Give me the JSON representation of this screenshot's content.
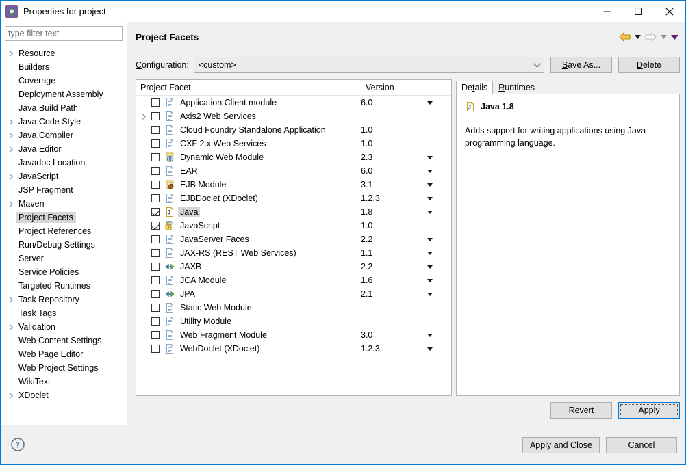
{
  "window": {
    "title": "Properties for project",
    "icon": "project-properties-icon",
    "minimize_label": "minimize-icon",
    "maximize_label": "maximize-icon",
    "close_label": "close-icon"
  },
  "sidebar": {
    "filter_placeholder": "type filter text",
    "filter_value": "",
    "items": [
      {
        "label": "Resource",
        "expandable": true,
        "selected": false
      },
      {
        "label": "Builders",
        "expandable": false,
        "selected": false
      },
      {
        "label": "Coverage",
        "expandable": false,
        "selected": false
      },
      {
        "label": "Deployment Assembly",
        "expandable": false,
        "selected": false
      },
      {
        "label": "Java Build Path",
        "expandable": false,
        "selected": false
      },
      {
        "label": "Java Code Style",
        "expandable": true,
        "selected": false
      },
      {
        "label": "Java Compiler",
        "expandable": true,
        "selected": false
      },
      {
        "label": "Java Editor",
        "expandable": true,
        "selected": false
      },
      {
        "label": "Javadoc Location",
        "expandable": false,
        "selected": false
      },
      {
        "label": "JavaScript",
        "expandable": true,
        "selected": false
      },
      {
        "label": "JSP Fragment",
        "expandable": false,
        "selected": false
      },
      {
        "label": "Maven",
        "expandable": true,
        "selected": false
      },
      {
        "label": "Project Facets",
        "expandable": false,
        "selected": true
      },
      {
        "label": "Project References",
        "expandable": false,
        "selected": false
      },
      {
        "label": "Run/Debug Settings",
        "expandable": false,
        "selected": false
      },
      {
        "label": "Server",
        "expandable": false,
        "selected": false
      },
      {
        "label": "Service Policies",
        "expandable": false,
        "selected": false
      },
      {
        "label": "Targeted Runtimes",
        "expandable": false,
        "selected": false
      },
      {
        "label": "Task Repository",
        "expandable": true,
        "selected": false
      },
      {
        "label": "Task Tags",
        "expandable": false,
        "selected": false
      },
      {
        "label": "Validation",
        "expandable": true,
        "selected": false
      },
      {
        "label": "Web Content Settings",
        "expandable": false,
        "selected": false
      },
      {
        "label": "Web Page Editor",
        "expandable": false,
        "selected": false
      },
      {
        "label": "Web Project Settings",
        "expandable": false,
        "selected": false
      },
      {
        "label": "WikiText",
        "expandable": false,
        "selected": false
      },
      {
        "label": "XDoclet",
        "expandable": true,
        "selected": false
      }
    ]
  },
  "page": {
    "title": "Project Facets",
    "nav": {
      "back_icon": "back-arrow-icon",
      "back_menu_icon": "chevron-down-icon",
      "forward_icon": "forward-arrow-icon",
      "forward_menu_icon": "chevron-down-icon",
      "view_menu_icon": "chevron-down-icon"
    }
  },
  "configuration": {
    "label": "Configuration:",
    "label_mnemonic": "C",
    "selected": "<custom>",
    "dropdown_icon": "chevron-down-icon",
    "save_as_label": "Save As...",
    "save_as_mnemonic": "S",
    "delete_label": "Delete",
    "delete_mnemonic": "D"
  },
  "facet_table": {
    "columns": [
      "Project Facet",
      "Version",
      ""
    ],
    "rows": [
      {
        "name": "Application Client module",
        "version": "6.0",
        "checked": false,
        "icon": "document-icon",
        "expandable": false,
        "has_version_menu": true
      },
      {
        "name": "Axis2 Web Services",
        "version": "",
        "checked": false,
        "icon": "document-icon",
        "expandable": true,
        "has_version_menu": false
      },
      {
        "name": "Cloud Foundry Standalone Application",
        "version": "1.0",
        "checked": false,
        "icon": "document-icon",
        "expandable": false,
        "has_version_menu": false
      },
      {
        "name": "CXF 2.x Web Services",
        "version": "1.0",
        "checked": false,
        "icon": "document-icon",
        "expandable": false,
        "has_version_menu": false
      },
      {
        "name": "Dynamic Web Module",
        "version": "2.3",
        "checked": false,
        "icon": "web-module-icon",
        "expandable": false,
        "has_version_menu": true
      },
      {
        "name": "EAR",
        "version": "6.0",
        "checked": false,
        "icon": "document-icon",
        "expandable": false,
        "has_version_menu": true
      },
      {
        "name": "EJB Module",
        "version": "3.1",
        "checked": false,
        "icon": "ejb-module-icon",
        "expandable": false,
        "has_version_menu": true
      },
      {
        "name": "EJBDoclet (XDoclet)",
        "version": "1.2.3",
        "checked": false,
        "icon": "document-icon",
        "expandable": false,
        "has_version_menu": true
      },
      {
        "name": "Java",
        "version": "1.8",
        "checked": true,
        "icon": "java-icon",
        "expandable": false,
        "has_version_menu": true,
        "selected": true
      },
      {
        "name": "JavaScript",
        "version": "1.0",
        "checked": true,
        "icon": "javascript-locked-icon",
        "expandable": false,
        "has_version_menu": false
      },
      {
        "name": "JavaServer Faces",
        "version": "2.2",
        "checked": false,
        "icon": "document-icon",
        "expandable": false,
        "has_version_menu": true
      },
      {
        "name": "JAX-RS (REST Web Services)",
        "version": "1.1",
        "checked": false,
        "icon": "document-icon",
        "expandable": false,
        "has_version_menu": true
      },
      {
        "name": "JAXB",
        "version": "2.2",
        "checked": false,
        "icon": "binding-arrows-icon",
        "expandable": false,
        "has_version_menu": true
      },
      {
        "name": "JCA Module",
        "version": "1.6",
        "checked": false,
        "icon": "document-icon",
        "expandable": false,
        "has_version_menu": true
      },
      {
        "name": "JPA",
        "version": "2.1",
        "checked": false,
        "icon": "binding-arrows-icon",
        "expandable": false,
        "has_version_menu": true
      },
      {
        "name": "Static Web Module",
        "version": "",
        "checked": false,
        "icon": "document-icon",
        "expandable": false,
        "has_version_menu": false
      },
      {
        "name": "Utility Module",
        "version": "",
        "checked": false,
        "icon": "document-icon",
        "expandable": false,
        "has_version_menu": false
      },
      {
        "name": "Web Fragment Module",
        "version": "3.0",
        "checked": false,
        "icon": "document-icon",
        "expandable": false,
        "has_version_menu": true
      },
      {
        "name": "WebDoclet (XDoclet)",
        "version": "1.2.3",
        "checked": false,
        "icon": "document-icon",
        "expandable": false,
        "has_version_menu": true
      }
    ]
  },
  "details_panel": {
    "tabs": [
      {
        "label": "Details",
        "mnemonic": "t",
        "active": true
      },
      {
        "label": "Runtimes",
        "mnemonic": "R",
        "active": false
      }
    ],
    "facet_title": "Java 1.8",
    "facet_icon": "java-icon",
    "description": "Adds support for writing applications using Java programming language."
  },
  "actions": {
    "revert_label": "Revert",
    "apply_label": "Apply",
    "apply_mnemonic": "A",
    "apply_and_close_label": "Apply and Close",
    "cancel_label": "Cancel",
    "help_icon": "help-icon"
  },
  "colors": {
    "accent": "#0078d7",
    "back_arrow": "#e3a01e",
    "forward_arrow": "#b8b8b8",
    "menu_arrow": "#5a1b7a",
    "selection": "#d6d6d6"
  }
}
